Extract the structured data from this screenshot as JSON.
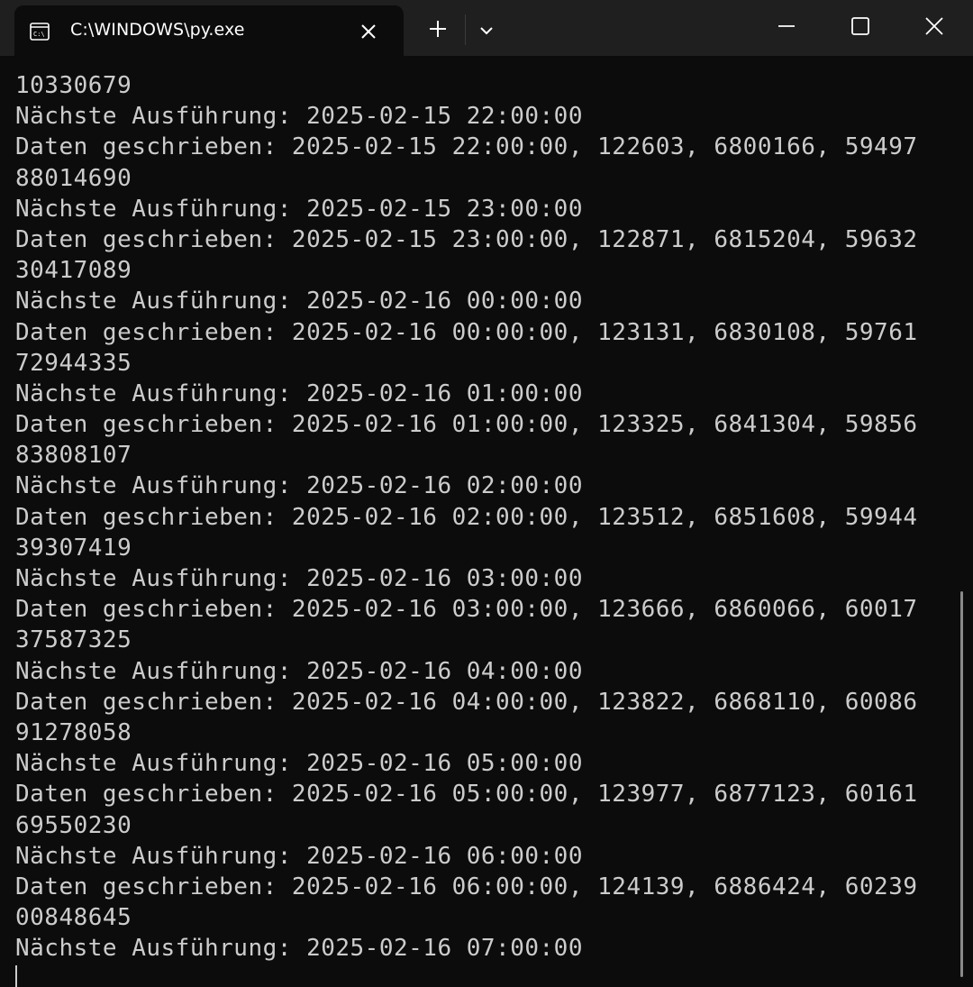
{
  "window": {
    "tab_title": "C:\\WINDOWS\\py.exe",
    "icons": {
      "tab": "console-app-icon",
      "close_tab": "close-icon",
      "new_tab": "plus-icon",
      "dropdown": "chevron-down-icon",
      "minimize": "minimize-icon",
      "maximize": "maximize-icon",
      "close_window": "close-icon"
    }
  },
  "console": {
    "lines": [
      "10330679",
      "Nächste Ausführung: 2025-02-15 22:00:00",
      "Daten geschrieben: 2025-02-15 22:00:00, 122603, 6800166, 59497",
      "88014690",
      "Nächste Ausführung: 2025-02-15 23:00:00",
      "Daten geschrieben: 2025-02-15 23:00:00, 122871, 6815204, 59632",
      "30417089",
      "Nächste Ausführung: 2025-02-16 00:00:00",
      "Daten geschrieben: 2025-02-16 00:00:00, 123131, 6830108, 59761",
      "72944335",
      "Nächste Ausführung: 2025-02-16 01:00:00",
      "Daten geschrieben: 2025-02-16 01:00:00, 123325, 6841304, 59856",
      "83808107",
      "Nächste Ausführung: 2025-02-16 02:00:00",
      "Daten geschrieben: 2025-02-16 02:00:00, 123512, 6851608, 59944",
      "39307419",
      "Nächste Ausführung: 2025-02-16 03:00:00",
      "Daten geschrieben: 2025-02-16 03:00:00, 123666, 6860066, 60017",
      "37587325",
      "Nächste Ausführung: 2025-02-16 04:00:00",
      "Daten geschrieben: 2025-02-16 04:00:00, 123822, 6868110, 60086",
      "91278058",
      "Nächste Ausführung: 2025-02-16 05:00:00",
      "Daten geschrieben: 2025-02-16 05:00:00, 123977, 6877123, 60161",
      "69550230",
      "Nächste Ausführung: 2025-02-16 06:00:00",
      "Daten geschrieben: 2025-02-16 06:00:00, 124139, 6886424, 60239",
      "00848645",
      "Nächste Ausführung: 2025-02-16 07:00:00"
    ]
  },
  "colors": {
    "background": "#0c0c0c",
    "titlebar": "#1f1f1f",
    "text": "#cccccc",
    "title_text": "#ffffff"
  }
}
